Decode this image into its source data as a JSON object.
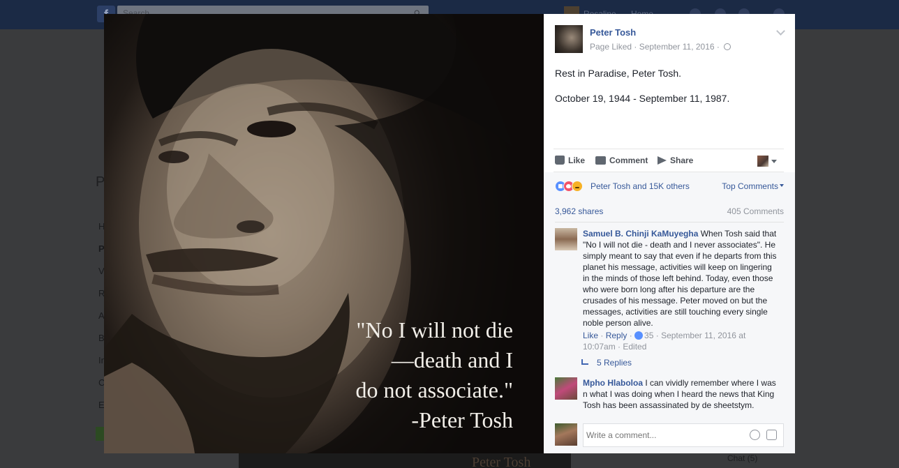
{
  "background": {
    "search_placeholder": "Search",
    "username": "Rosaline",
    "home_label": "Home",
    "bottom_photo_text": "Peter Tosh",
    "chat_label": "Chat (5)",
    "left_menu_letters": [
      "H",
      "P",
      "V",
      "R",
      "A",
      "B",
      "In",
      "C",
      "E"
    ]
  },
  "photo": {
    "quote_lines": [
      "\"No I will not die",
      "—death and I",
      "do not associate.\"",
      "-Peter Tosh"
    ]
  },
  "post": {
    "author": "Peter Tosh",
    "meta": "Page Liked · September 11, 2016 ·",
    "text_lines": [
      "Rest in Paradise, Peter Tosh.",
      "October 19, 1944 - September 11, 1987."
    ]
  },
  "actions": {
    "like": "Like",
    "comment": "Comment",
    "share": "Share"
  },
  "engagement": {
    "reactions_summary": "Peter Tosh and 15K others",
    "sort_label": "Top Comments",
    "shares": "3,962 shares",
    "comment_count": "405 Comments"
  },
  "comments": [
    {
      "author": "Samuel B. Chinji KaMuyegha",
      "text": "When Tosh said that \"No I will not die - death and I never associates\". He simply meant to say that even if he departs from this planet his message, activities will keep on lingering in the minds of those left behind. Today, even those who were born long after his departure are the crusades of his message. Peter moved on but the messages, activities are still touching every single noble person alive.",
      "like_label": "Like",
      "reply_label": "Reply",
      "like_count": "35",
      "timestamp": "September 11, 2016 at 10:07am",
      "edited": "Edited",
      "replies": "5 Replies"
    },
    {
      "author": "Mpho Hlaboloa",
      "text": "I can vividly remember where I was n what I was doing when I heard the news that King Tosh has been assassinated by de sheetstym."
    }
  ],
  "composer": {
    "placeholder": "Write a comment..."
  },
  "colors": {
    "link": "#365899",
    "meta": "#90949c",
    "like_reaction": "#5890ff",
    "love_reaction": "#f25268",
    "sad_reaction": "#f7b125"
  }
}
